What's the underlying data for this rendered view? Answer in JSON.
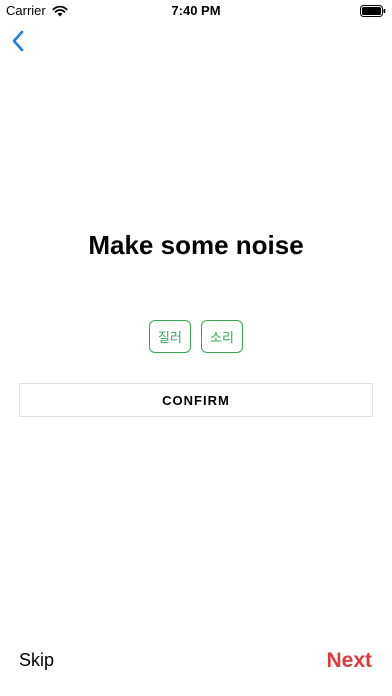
{
  "status_bar": {
    "carrier": "Carrier",
    "time": "7:40 PM"
  },
  "nav": {
    "back_icon": "chevron-left-icon",
    "accent_color": "#1a7fe0"
  },
  "main": {
    "title": "Make some noise",
    "options": [
      "질러",
      "소리"
    ],
    "option_color": "#34a853",
    "confirm_label": "CONFIRM"
  },
  "footer": {
    "skip_label": "Skip",
    "next_label": "Next",
    "next_color": "#e0393e"
  }
}
